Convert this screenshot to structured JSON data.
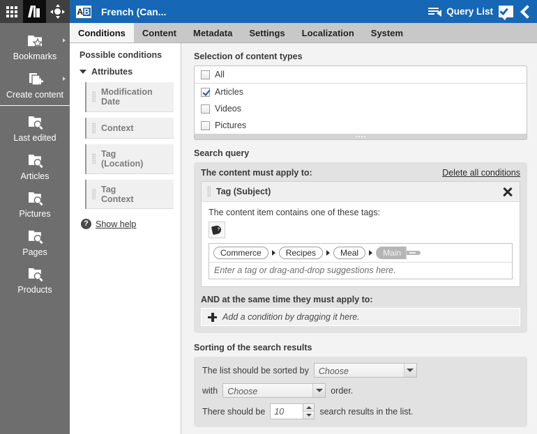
{
  "rail": {
    "top_icons": [
      {
        "name": "apps-grid-icon",
        "label": "Apps"
      },
      {
        "name": "library-logo-icon",
        "label": "Library"
      },
      {
        "name": "move-navigate-icon",
        "label": "Navigate"
      }
    ],
    "items": [
      {
        "label": "Bookmarks",
        "icon": "folder-star-icon",
        "has_submenu": true
      },
      {
        "label": "Create content",
        "icon": "page-plus-icon",
        "has_submenu": true
      },
      {
        "label": "Last edited",
        "icon": "folder-search-icon",
        "has_submenu": false
      },
      {
        "label": "Articles",
        "icon": "folder-search-icon",
        "has_submenu": false
      },
      {
        "label": "Pictures",
        "icon": "folder-search-icon",
        "has_submenu": false
      },
      {
        "label": "Pages",
        "icon": "folder-search-icon",
        "has_submenu": false
      },
      {
        "label": "Products",
        "icon": "folder-search-icon",
        "has_submenu": false
      }
    ]
  },
  "titlebar": {
    "icon": "ab-language-icon",
    "icon_letter_a": "A",
    "icon_letter_b": "B",
    "title": "French (Can...",
    "query_list_icon": "query-list-icon",
    "query_list_label": "Query List",
    "bubble_icon": "speech-bubble-check-icon",
    "collapse_icon": "chevron-left-icon",
    "accent_color": "#1667b6"
  },
  "tabs": [
    {
      "label": "Conditions",
      "active": true
    },
    {
      "label": "Content",
      "active": false
    },
    {
      "label": "Metadata",
      "active": false
    },
    {
      "label": "Settings",
      "active": false
    },
    {
      "label": "Localization",
      "active": false
    },
    {
      "label": "System",
      "active": false
    }
  ],
  "conditions_panel": {
    "title": "Possible conditions",
    "group_label": "Attributes",
    "items": [
      {
        "label": "Modification Date"
      },
      {
        "label": "Context"
      },
      {
        "label": "Tag\n(Location)",
        "line1": "Tag",
        "line2": "(Location)"
      },
      {
        "label": "Tag\nContext",
        "line1": "Tag",
        "line2": "Context"
      }
    ],
    "help_icon": "question-mark-icon",
    "help_label": "Show help"
  },
  "content_types": {
    "section_title": "Selection of content types",
    "options": [
      {
        "label": "All",
        "checked": false,
        "separator": true
      },
      {
        "label": "Articles",
        "checked": true,
        "separator": false
      },
      {
        "label": "Videos",
        "checked": false,
        "separator": false
      },
      {
        "label": "Pictures",
        "checked": false,
        "separator": false
      }
    ]
  },
  "search_query": {
    "section_title": "Search query",
    "must_apply_label": "The content must apply to:",
    "delete_all_label": "Delete all conditions",
    "condition": {
      "title": "Tag (Subject)",
      "close_icon": "close-x-icon",
      "description": "The content item contains one of these tags:",
      "tag_picker_icon": "tag-question-icon",
      "tags": [
        {
          "label": "Commerce",
          "selected": false
        },
        {
          "label": "Recipes",
          "selected": false
        },
        {
          "label": "Meal",
          "selected": false
        },
        {
          "label": "Main",
          "selected": true
        }
      ],
      "input_placeholder": "Enter a tag or drag-and-drop suggestions here."
    },
    "and_label": "AND at the same time they must apply to:",
    "dropzone_icon": "plus-icon",
    "dropzone_text": "Add a condition by dragging it here."
  },
  "sorting": {
    "section_title": "Sorting of the search results",
    "sorted_by_prefix": "The list should be sorted by",
    "sorted_by_value": "Choose",
    "order_prefix": "with",
    "order_value": "Choose",
    "order_suffix": "order.",
    "count_prefix": "There should be",
    "count_value": "10",
    "count_suffix": "search results in the list."
  }
}
